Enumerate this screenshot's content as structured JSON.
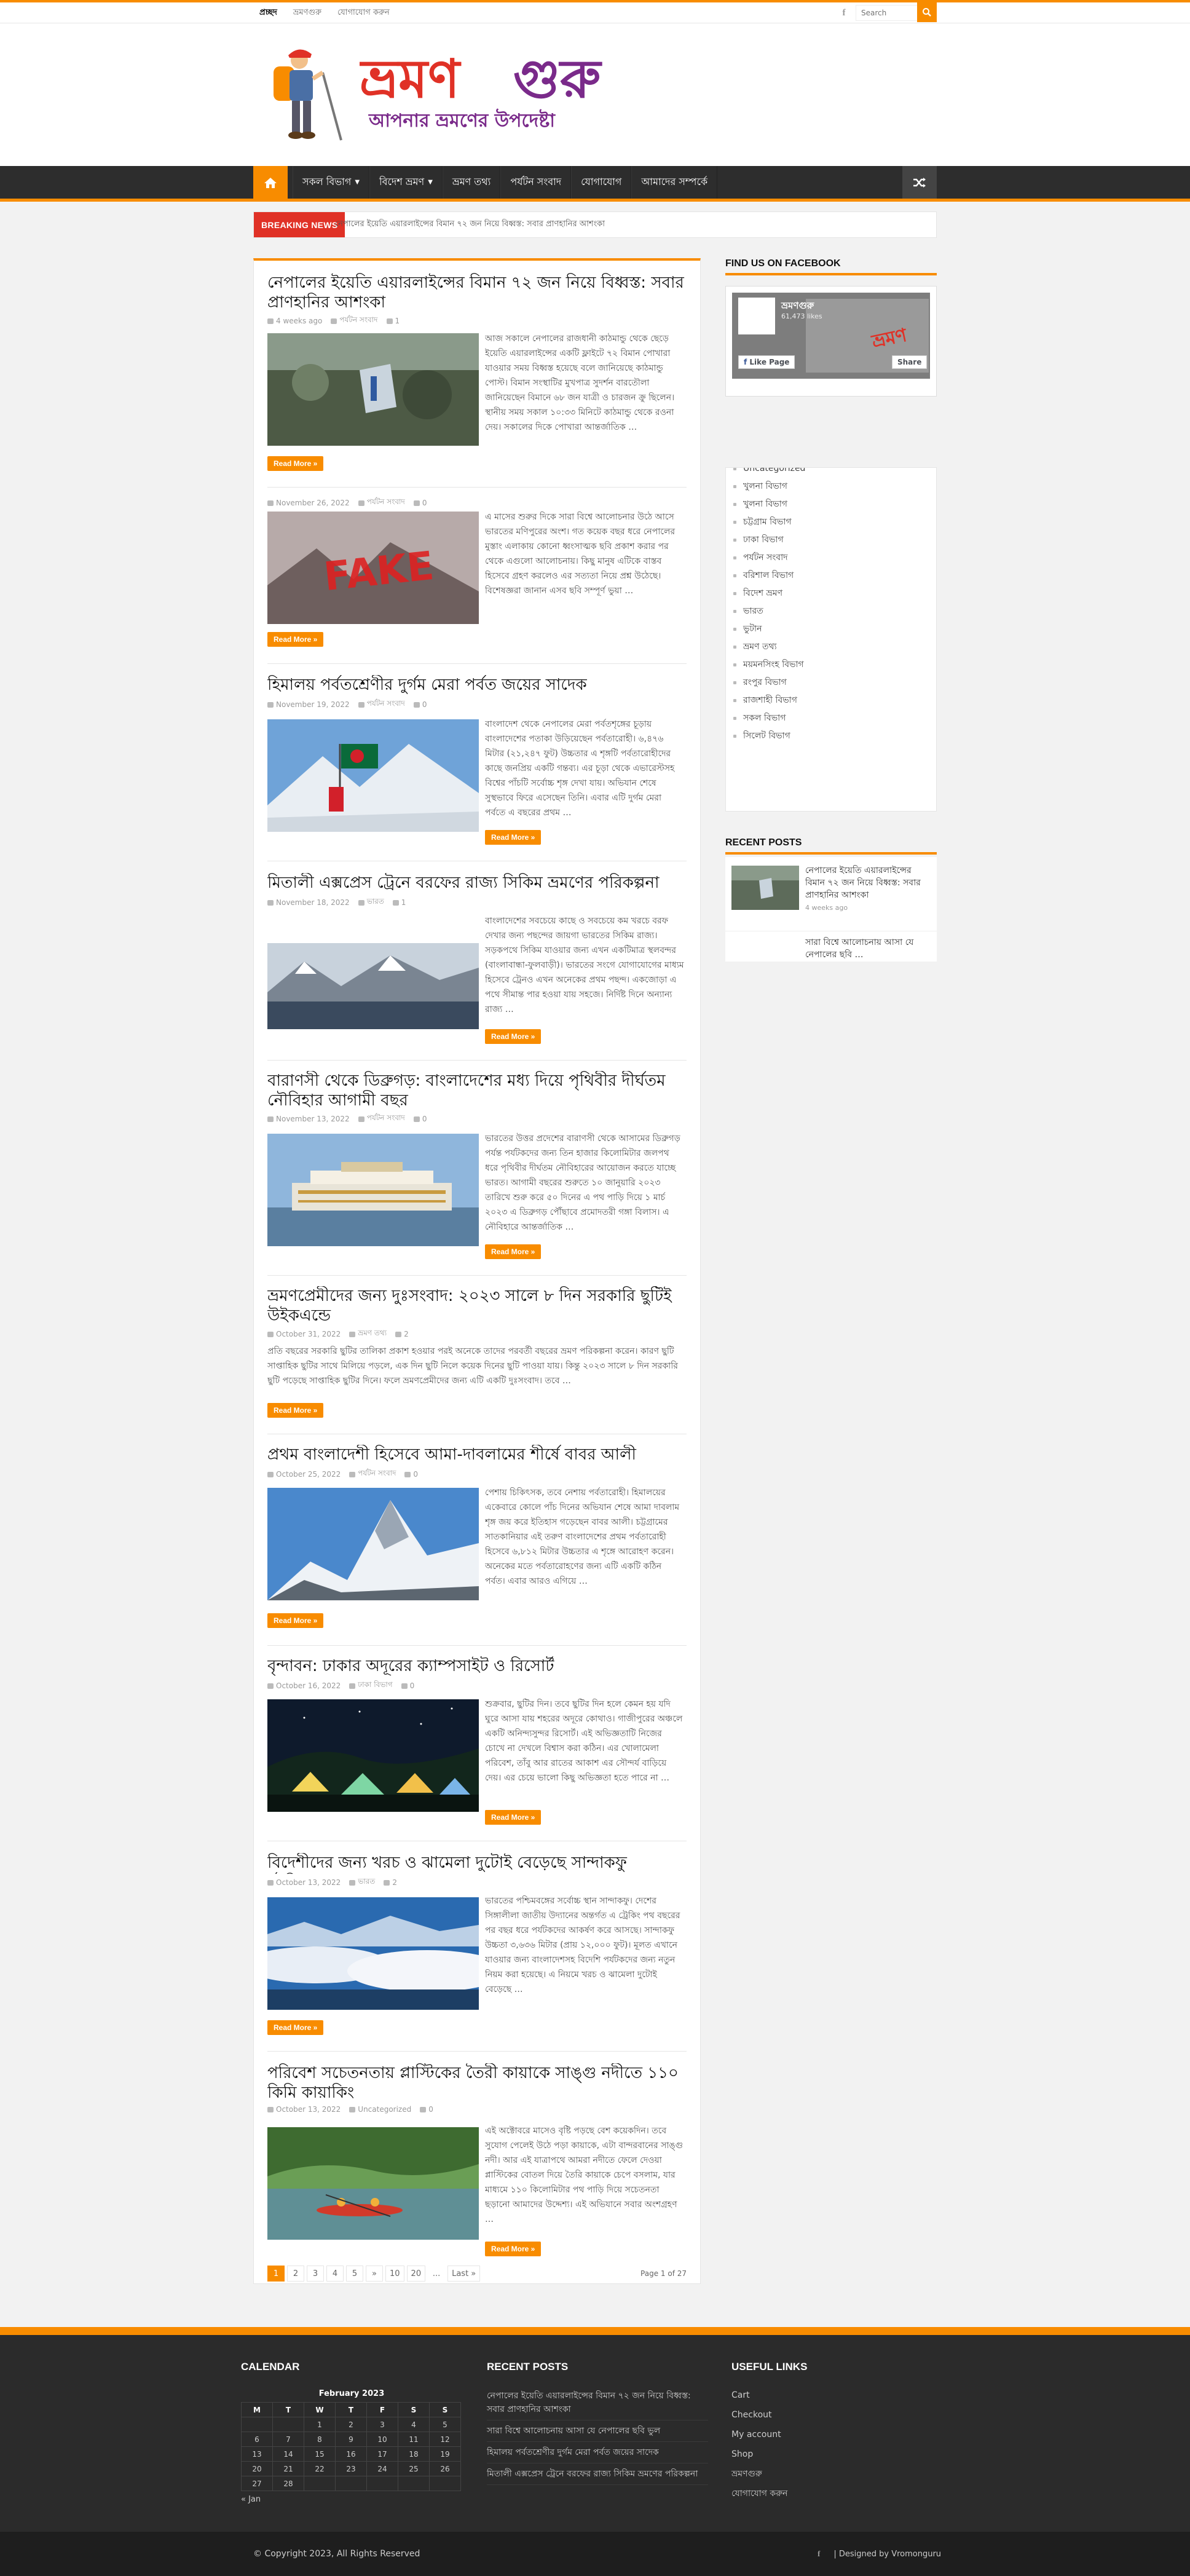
{
  "brand": {
    "accent": "#f88c00",
    "breaking_red": "#e03126",
    "logo_text": "ভ্রমণগুরু",
    "logo_tagline": "আপনার ভ্রমণের উপদেষ্টা"
  },
  "topbar": {
    "links": [
      "প্রচ্ছদ",
      "ভ্রমণগুরু",
      "যোগাযোগ করুন"
    ],
    "facebook_icon": "facebook-icon",
    "search_placeholder": "Search"
  },
  "mainnav": {
    "home_icon": "home-icon",
    "items": [
      "সকল বিভাগ",
      "বিদেশ ভ্রমণ",
      "ভ্রমণ তথ্য",
      "পর্যটন সংবাদ",
      "যোগাযোগ",
      "আমাদের সম্পর্কে"
    ],
    "shuffle_icon": "shuffle-icon"
  },
  "ticker": {
    "label": "BREAKING NEWS",
    "text": "নেপালের ইয়েতি এয়ারলাইন্সের বিমান ৭২ জন নিয়ে বিধ্বস্ত: সবার প্রাণহানির আশংকা"
  },
  "posts": [
    {
      "title": "নেপালের ইয়েতি এয়ারলাইন্সের বিমান ৭২ জন নিয়ে বিধ্বস্ত: সবার প্রাণহানির আশংকা",
      "date": "4 weeks ago",
      "category": "পর্যটন সংবাদ",
      "comments": "1",
      "excerpt": "আজ সকালে নেপালের রাজধানী কাঠমান্ডু থেকে ছেড়ে ইয়েতি এয়ারলাইন্সের একটি ফ্লাইটে ৭২ বিমান পোখারা যাওয়ার সময় বিধ্বস্ত হয়েছে বলে জানিয়েছে কাঠমান্ডু পোস্ট। বিমান সংস্থাটির মুখপাত্র সুদর্শন বারতৌলা জানিয়েছেন বিমানে ৬৮ জন যাত্রী ও চারজন ক্রু ছিলেন। স্থানীয় সময় সকাল ১০:৩৩ মিনিটে কাঠমান্ডু থেকে রওনা দেয়। সকালের দিকে পোখারা আন্তর্জাতিক …",
      "readmore": "Read More »"
    },
    {
      "title": "",
      "date": "November 26, 2022",
      "category": "পর্যটন সংবাদ",
      "comments": "0",
      "excerpt": "এ মাসের শুরুর দিকে সারা বিশ্বে আলোচনার উঠে আসে ভারতের মণিপুরের অংশ। গত কয়েক বছর ধরে নেপালের মুস্তাং এলাকায় কোনো ধ্বংসাত্মক ছবি প্রকাশ করার পর থেকে এগুলো আলোচনায়। কিছু মানুষ এটিকে বাস্তব হিসেবে গ্রহণ করলেও এর সত্যতা নিয়ে প্রশ্ন উঠেছে। বিশেষজ্ঞরা জানান এসব ছবি সম্পূর্ণ ভুয়া …",
      "readmore": "Read More »"
    },
    {
      "title": "হিমালয় পর্বতশ্রেণীর দুর্গম মেরা পর্বত জয়ের সাদেক",
      "date": "November 19, 2022",
      "category": "পর্যটন সংবাদ",
      "comments": "0",
      "excerpt": "বাংলাদেশ থেকে নেপালের মেরা পর্বতশৃঙ্গের চূড়ায় বাংলাদেশের পতাকা উড়িয়েছেন পর্বতারোহী। ৬,৪৭৬ মিটার (২১,২৪৭ ফুট) উচ্চতার এ শৃঙ্গটি পর্বতারোহীদের কাছে জনপ্রিয় একটি গন্তব্য। এর চূড়া থেকে এভারেস্টসহ বিশ্বের পাঁচটি সর্বোচ্চ শৃঙ্গ দেখা যায়। অভিযান শেষে সুস্থভাবে ফিরে এসেছেন তিনি। এবার এটি দুর্গম মেরা পর্বতে এ বছরের প্রথম …",
      "readmore": "Read More »"
    },
    {
      "title": "মিতালী এক্সপ্রেস ট্রেনে বরফের রাজ্য সিকিম ভ্রমণের পরিকল্পনা",
      "date": "November 18, 2022",
      "category": "ভারত",
      "comments": "1",
      "excerpt": "বাংলাদেশের সবচেয়ে কাছে ও সবচেয়ে কম খরচে বরফ দেখার জন্য পছন্দের জায়গা ভারতের সিকিম রাজ্য। সড়কপথে সিকিম যাওয়ার জন্য এখন একটিমাত্র স্থলবন্দর (বাংলাবান্ধা-ফুলবাড়ী)। ভারতের সংগে যোগাযোগের মাধ্যম হিসেবে ট্রেনও এখন অনেকের প্রথম পছন্দ। একজোড়া এ পথে সীমান্ত পার হওয়া যায় সহজে। নির্দিষ্ট দিনে অন্যান্য রাজ্য …",
      "readmore": "Read More »"
    },
    {
      "title": "বারাণসী থেকে ডিব্রুগড়: বাংলাদেশের মধ্য দিয়ে পৃথিবীর দীর্ঘতম নৌবিহার আগামী বছর",
      "date": "November 13, 2022",
      "category": "পর্যটন সংবাদ",
      "comments": "0",
      "excerpt": "ভারতের উত্তর প্রদেশের বারাণসী থেকে আসামের ডিব্রুগড় পর্যন্ত পর্যটকদের জন্য তিন হাজার কিলোমিটার জলপথ ধরে পৃথিবীর দীর্ঘতম নৌবিহারের আয়োজন করতে যাচ্ছে ভারত। আগামী বছরের শুরুতে ১০ জানুয়ারি ২০২৩ তারিখে শুরু করে ৫০ দিনের এ পথ পাড়ি দিয়ে ১ মার্চ ২০২৩ এ ডিব্রুগড় পৌঁছাবে প্রমোদতরী গঙ্গা বিলাস। এ নৌবিহারে আন্তর্জাতিক …",
      "readmore": "Read More »"
    },
    {
      "title": "ভ্রমণপ্রেমীদের জন্য দুঃসংবাদ: ২০২৩ সালে ৮ দিন সরকারি ছুটিই উইকএন্ডে",
      "date": "October 31, 2022",
      "category": "ভ্রমণ তথ্য",
      "comments": "2",
      "excerpt": "প্রতি বছরের সরকারি ছুটির তালিকা প্রকাশ হওয়ার পরই অনেকে তাদের পরবর্তী বছরের ভ্রমণ পরিকল্পনা করেন। কারণ ছুটি সাপ্তাহিক ছুটির সাথে মিলিয়ে পড়লে, এক দিন ছুটি নিলে কয়েক দিনের ছুটি পাওয়া যায়। কিন্তু ২০২৩ সালে ৮ দিন সরকারি ছুটি পড়েছে সাপ্তাহিক ছুটির দিনে। ফলে ভ্রমণপ্রেমীদের জন্য এটি একটি দুঃসংবাদ। তবে …",
      "readmore": "Read More »"
    },
    {
      "title": "প্রথম বাংলাদেশী হিসেবে আমা-দাবলামের শীর্ষে বাবর আলী",
      "date": "October 25, 2022",
      "category": "পর্যটন সংবাদ",
      "comments": "0",
      "excerpt": "পেশায় চিকিৎসক, তবে নেশায় পর্বতারোহী। হিমালয়ের একেবারে কোলে পাঁচ দিনের অভিযান শেষে আমা দাবলাম শৃঙ্গ জয় করে ইতিহাস গড়েছেন বাবর আলী। চট্টগ্রামের সাতকানিয়ার এই তরুণ বাংলাদেশের প্রথম পর্বতারোহী হিসেবে ৬,৮১২ মিটার উচ্চতার এ শৃঙ্গে আরোহণ করেন। অনেকের মতে পর্বতারোহণের জন্য এটি একটি কঠিন পর্বত। এবার আরও এগিয়ে …",
      "readmore": "Read More »"
    },
    {
      "title": "বৃন্দাবন: ঢাকার অদূরের ক্যাম্পসাইট ও রিসোর্ট",
      "date": "October 16, 2022",
      "category": "ঢাকা বিভাগ",
      "comments": "0",
      "excerpt": "শুক্রবার, ছুটির দিন। তবে ছুটির দিন হলে কেমন হয় যদি ঘুরে আসা যায় শহরের অদূরে কোথাও। গাজীপুরের অঞ্চলে একটি অনিন্দ্যসুন্দর রিসোর্ট। এই অভিজ্ঞতাটি নিজের চোখে না দেখলে বিশ্বাস করা কঠিন। এর খোলামেলা পরিবেশ, তাঁবু আর রাতের আকাশ এর সৌন্দর্য বাড়িয়ে দেয়। এর চেয়ে ভালো কিছু অভিজ্ঞতা হতে পারে না …",
      "readmore": "Read More »"
    },
    {
      "title": "বিদেশীদের জন্য খরচ ও ঝামেলা দুটোই বেড়েছে সান্দাকফু ট্রেকিংয়ে",
      "date": "October 13, 2022",
      "category": "ভারত",
      "comments": "2",
      "excerpt": "ভারতের পশ্চিমবঙ্গের সর্বোচ্চ স্থান সান্দাকফু। দেশের সিঙ্গালীলা জাতীয় উদ্যানের অন্তর্গত এ ট্রেকিং পথ বছরের পর বছর ধরে পর্যটকদের আকর্ষণ করে আসছে। সান্দাকফু উচ্চতা ৩,৬৩৬ মিটার (প্রায় ১২,০০০ ফুট)। মূলত এখানে যাওয়ার জন্য বাংলাদেশসহ বিদেশি পর্যটকদের জন্য নতুন নিয়ম করা হয়েছে। এ নিয়মে খরচ ও ঝামেলা দুটোই বেড়েছে …",
      "readmore": "Read More »"
    },
    {
      "title": "পরিবেশ সচেতনতায় প্লাস্টিকের তৈরী কায়াকে সাঙ্গু নদীতে ১১০ কিমি কায়াকিং",
      "date": "October 13, 2022",
      "category": "Uncategorized",
      "comments": "0",
      "excerpt": "এই অক্টোবরে মাসেও বৃষ্টি পড়ছে বেশ কয়েকদিন। তবে সুযোগ পেলেই উঠে পড়া কায়াকে, এটা বান্দরবানের সাঙ্গু নদী। আর এই যাত্রাপথে আমরা নদীতে ফেলে দেওয়া প্লাস্টিকের বোতল দিয়ে তৈরি কায়াকে চেপে বসলাম, যার মাধ্যমে ১১০ কিলোমিটার পথ পাড়ি দিয়ে সচেতনতা ছড়ানো আমাদের উদ্দেশ্য। এই অভিযানে সবার অংশগ্রহণ …",
      "readmore": "Read More »"
    }
  ],
  "pagination": {
    "pages": [
      "1",
      "2",
      "3",
      "4",
      "5",
      "»",
      "10",
      "20",
      "...",
      "Last »"
    ],
    "page_of": "Page 1 of 27"
  },
  "sidebar": {
    "facebook": {
      "title": "FIND US ON FACEBOOK",
      "page_name": "ভ্রমণগুরু",
      "likes": "61,473 likes",
      "like_btn": "Like Page",
      "share_btn": "Share"
    },
    "categories": [
      "Uncategorized",
      "খুলনা বিভাগ",
      "খুলনা বিভাগ",
      "চট্টগ্রাম বিভাগ",
      "ঢাকা বিভাগ",
      "পর্যটন সংবাদ",
      "বরিশাল বিভাগ",
      "বিদেশ ভ্রমণ",
      "ভারত",
      "ভুটান",
      "ভ্রমণ তথ্য",
      "ময়মনসিংহ বিভাগ",
      "রংপুর বিভাগ",
      "রাজশাহী বিভাগ",
      "সকল বিভাগ",
      "সিলেট বিভাগ"
    ],
    "recent_posts": {
      "title": "RECENT POSTS",
      "items": [
        {
          "title": "নেপালের ইয়েতি এয়ারলাইন্সের বিমান ৭২ জন নিয়ে বিধ্বস্ত: সবার প্রাণহানির আশংকা",
          "date": "4 weeks ago"
        },
        {
          "title": "সারা বিশ্বে আলোচনায় আসা যে নেপালের ছবি …",
          "date": ""
        }
      ]
    }
  },
  "footer": {
    "calendar": {
      "title": "CALENDAR",
      "caption": "February 2023",
      "weekdays": [
        "M",
        "T",
        "W",
        "T",
        "F",
        "S",
        "S"
      ],
      "rows": [
        [
          "",
          "",
          "1",
          "2",
          "3",
          "4",
          "5"
        ],
        [
          "6",
          "7",
          "8",
          "9",
          "10",
          "11",
          "12"
        ],
        [
          "13",
          "14",
          "15",
          "16",
          "17",
          "18",
          "19"
        ],
        [
          "20",
          "21",
          "22",
          "23",
          "24",
          "25",
          "26"
        ],
        [
          "27",
          "28",
          "",
          "",
          "",
          "",
          ""
        ]
      ],
      "prev": "« Jan"
    },
    "recent_posts": {
      "title": "RECENT POSTS",
      "items": [
        "নেপালের ইয়েতি এয়ারলাইন্সের বিমান ৭২ জন নিয়ে বিধ্বস্ত: সবার প্রাণহানির আশংকা",
        "সারা বিশ্বে আলোচনায় আসা যে নেপালের ছবি ভুল",
        "হিমালয় পর্বতশ্রেণীর দুর্গম মেরা পর্বত জয়ের সাদেক",
        "মিতালী এক্সপ্রেস ট্রেনে বরফের রাজ্য সিকিম ভ্রমণের পরিকল্পনা"
      ]
    },
    "useful_links": {
      "title": "USEFUL LINKS",
      "items": [
        "Cart",
        "Checkout",
        "My account",
        "Shop",
        "ভ্রমণগুরু",
        "যোগাযোগ করুন"
      ]
    },
    "copyright": "© Copyright 2023, All Rights Reserved",
    "designed": "| Designed by Vromonguru"
  }
}
